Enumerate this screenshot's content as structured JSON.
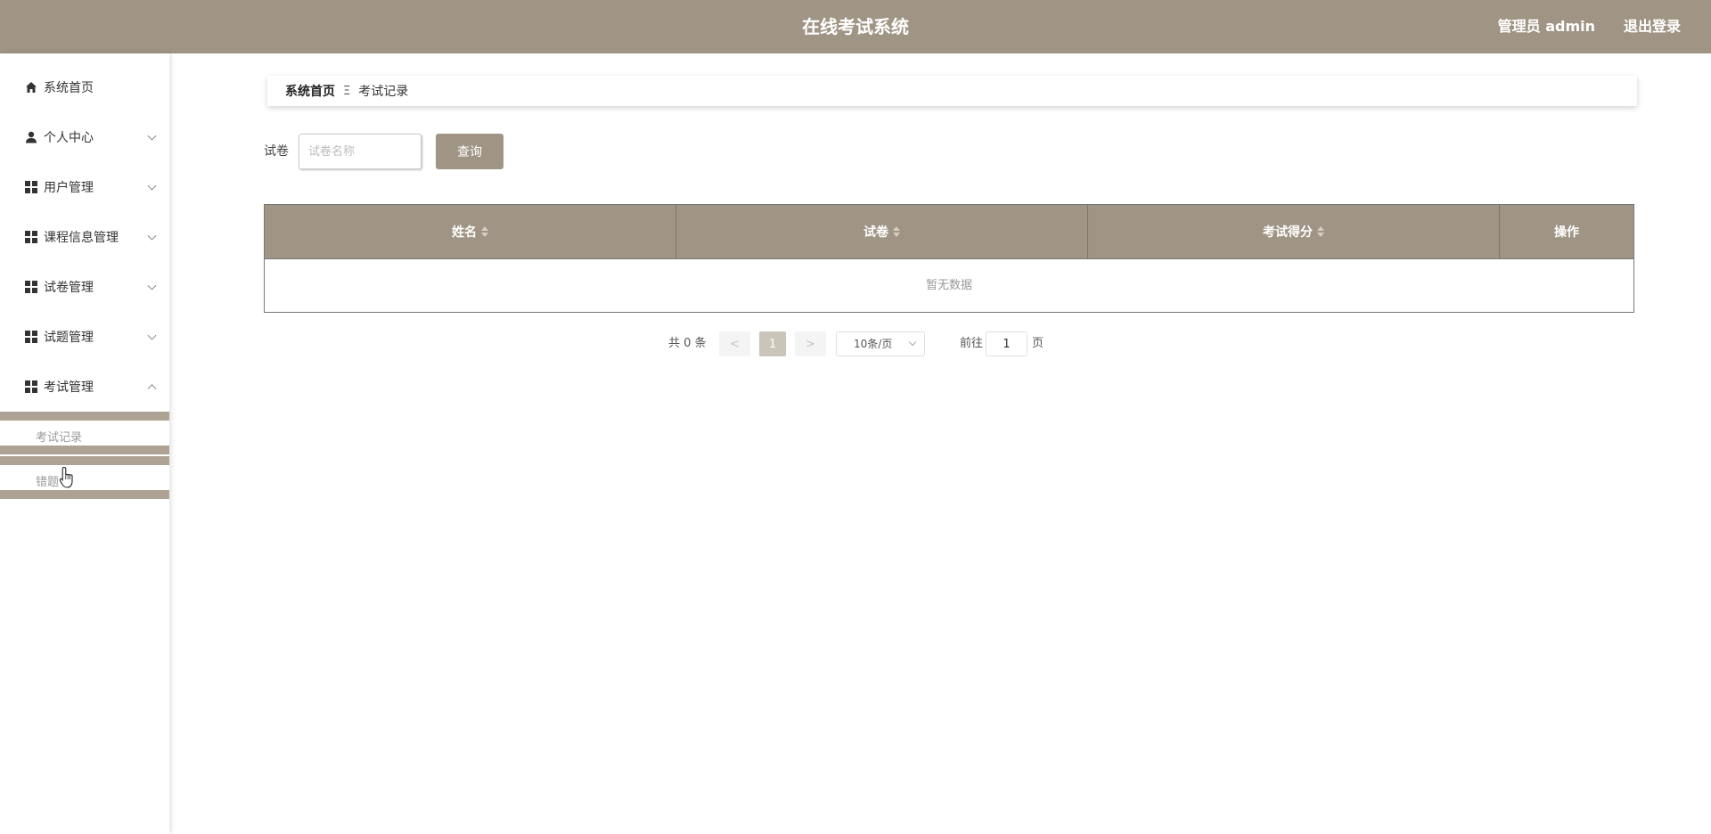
{
  "header": {
    "title": "在线考试系统",
    "user_label": "管理员 admin",
    "logout_label": "退出登录",
    "bg_color": "#a09585"
  },
  "sidebar": {
    "items": [
      {
        "label": "系统首页",
        "icon": "home-icon"
      },
      {
        "label": "个人中心",
        "icon": "user-icon"
      },
      {
        "label": "用户管理",
        "icon": "grid-icon"
      },
      {
        "label": "课程信息管理",
        "icon": "grid-icon"
      },
      {
        "label": "试卷管理",
        "icon": "grid-icon"
      },
      {
        "label": "试题管理",
        "icon": "grid-icon"
      },
      {
        "label": "考试管理",
        "icon": "grid-icon"
      }
    ],
    "sub_items": [
      {
        "label": "考试记录"
      },
      {
        "label": "错题"
      }
    ]
  },
  "breadcrumb": {
    "home": "系统首页",
    "separator": "Ξ",
    "current": "考试记录"
  },
  "search": {
    "label": "试卷",
    "placeholder": "试卷名称",
    "button": "查询"
  },
  "table": {
    "columns": [
      {
        "label": "姓名",
        "sortable": true
      },
      {
        "label": "试卷",
        "sortable": true
      },
      {
        "label": "考试得分",
        "sortable": true
      },
      {
        "label": "操作",
        "sortable": false
      }
    ],
    "empty_text": "暂无数据"
  },
  "pagination": {
    "total_text": "共 0 条",
    "prev": "<",
    "current_page": "1",
    "next": ">",
    "page_size": "10条/页",
    "goto_label": "前往",
    "goto_value": "1",
    "page_suffix": "页"
  }
}
